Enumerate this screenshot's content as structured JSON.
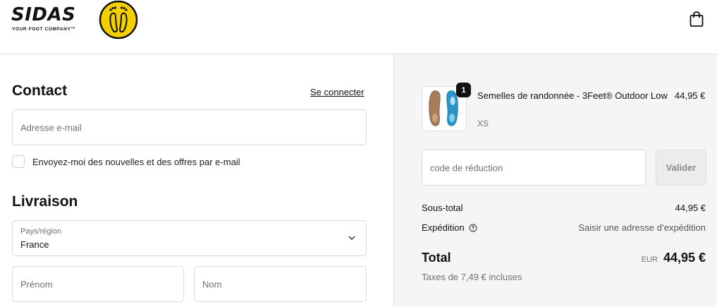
{
  "brand": {
    "name": "SIDAS",
    "tagline": "YOUR FOOT COMPANY™",
    "badge_color": "#f5d000"
  },
  "header": {
    "cart_icon": "shopping-bag-icon"
  },
  "contact": {
    "title": "Contact",
    "login_link": "Se connecter",
    "email_placeholder": "Adresse e-mail",
    "newsletter_label": "Envoyez-moi des nouvelles et des offres par e-mail",
    "newsletter_checked": false
  },
  "delivery": {
    "title": "Livraison",
    "country_label": "Pays/région",
    "country_value": "France",
    "first_name_placeholder": "Prénom",
    "last_name_placeholder": "Nom"
  },
  "summary": {
    "item": {
      "quantity": "1",
      "title": "Semelles de randonnée - 3Feet® Outdoor Low",
      "variant": "XS",
      "price": "44,95 €"
    },
    "discount_placeholder": "code de réduction",
    "apply_label": "Valider",
    "subtotal_label": "Sous-total",
    "subtotal_value": "44,95 €",
    "shipping_label": "Expédition",
    "shipping_value": "Saisir une adresse d’expédition",
    "total_label": "Total",
    "currency": "EUR",
    "total_value": "44,95 €",
    "tax_note": "Taxes de 7,49 € incluses"
  },
  "colors": {
    "summary_background": "#f5f5f5",
    "border": "#dedede",
    "text": "#111111",
    "muted_text": "#707070"
  }
}
